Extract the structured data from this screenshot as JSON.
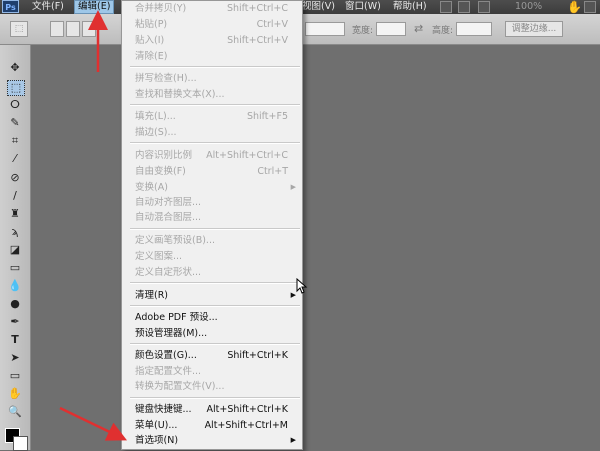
{
  "app": {
    "logo_text": "Ps"
  },
  "menubar": {
    "items": [
      {
        "label": "文件(F)",
        "active": false
      },
      {
        "label": "编辑(E)",
        "active": true
      },
      {
        "label": "视图(V)",
        "active": false
      },
      {
        "label": "窗口(W)",
        "active": false
      },
      {
        "label": "帮助(H)",
        "active": false
      }
    ],
    "zoom": "100%"
  },
  "options": {
    "width_label": "宽度:",
    "height_label": "高度:",
    "adjust_edge_label": "调整边缘...",
    "swap_icon": "swap-arrows"
  },
  "edit_menu": {
    "items": [
      {
        "label": "合并拷贝(Y)",
        "shortcut": "Shift+Ctrl+C",
        "enabled": false
      },
      {
        "label": "粘贴(P)",
        "shortcut": "Ctrl+V",
        "enabled": false
      },
      {
        "label": "贴入(I)",
        "shortcut": "Shift+Ctrl+V",
        "enabled": false
      },
      {
        "label": "清除(E)",
        "shortcut": "",
        "enabled": false
      },
      {
        "separator": true
      },
      {
        "label": "拼写检查(H)...",
        "shortcut": "",
        "enabled": false
      },
      {
        "label": "查找和替换文本(X)...",
        "shortcut": "",
        "enabled": false
      },
      {
        "separator": true
      },
      {
        "label": "填充(L)...",
        "shortcut": "Shift+F5",
        "enabled": false
      },
      {
        "label": "描边(S)...",
        "shortcut": "",
        "enabled": false
      },
      {
        "separator": true
      },
      {
        "label": "内容识别比例",
        "shortcut": "Alt+Shift+Ctrl+C",
        "enabled": false
      },
      {
        "label": "自由变换(F)",
        "shortcut": "Ctrl+T",
        "enabled": false
      },
      {
        "label": "变换(A)",
        "shortcut": "",
        "enabled": false,
        "submenu": true
      },
      {
        "label": "自动对齐图层...",
        "shortcut": "",
        "enabled": false
      },
      {
        "label": "自动混合图层...",
        "shortcut": "",
        "enabled": false
      },
      {
        "separator": true
      },
      {
        "label": "定义画笔预设(B)...",
        "shortcut": "",
        "enabled": false
      },
      {
        "label": "定义图案...",
        "shortcut": "",
        "enabled": false
      },
      {
        "label": "定义自定形状...",
        "shortcut": "",
        "enabled": false
      },
      {
        "separator": true
      },
      {
        "label": "清理(R)",
        "shortcut": "",
        "enabled": true,
        "submenu": true
      },
      {
        "separator": true
      },
      {
        "label": "Adobe PDF 预设...",
        "shortcut": "",
        "enabled": true
      },
      {
        "label": "预设管理器(M)...",
        "shortcut": "",
        "enabled": true
      },
      {
        "separator": true
      },
      {
        "label": "颜色设置(G)...",
        "shortcut": "Shift+Ctrl+K",
        "enabled": true
      },
      {
        "label": "指定配置文件...",
        "shortcut": "",
        "enabled": false
      },
      {
        "label": "转换为配置文件(V)...",
        "shortcut": "",
        "enabled": false
      },
      {
        "separator": true
      },
      {
        "label": "键盘快捷键...",
        "shortcut": "Alt+Shift+Ctrl+K",
        "enabled": true
      },
      {
        "label": "菜单(U)...",
        "shortcut": "Alt+Shift+Ctrl+M",
        "enabled": true
      },
      {
        "label": "首选项(N)",
        "shortcut": "",
        "enabled": true,
        "submenu": true
      }
    ]
  },
  "annotations": {
    "arrow_color": "#e03030"
  }
}
